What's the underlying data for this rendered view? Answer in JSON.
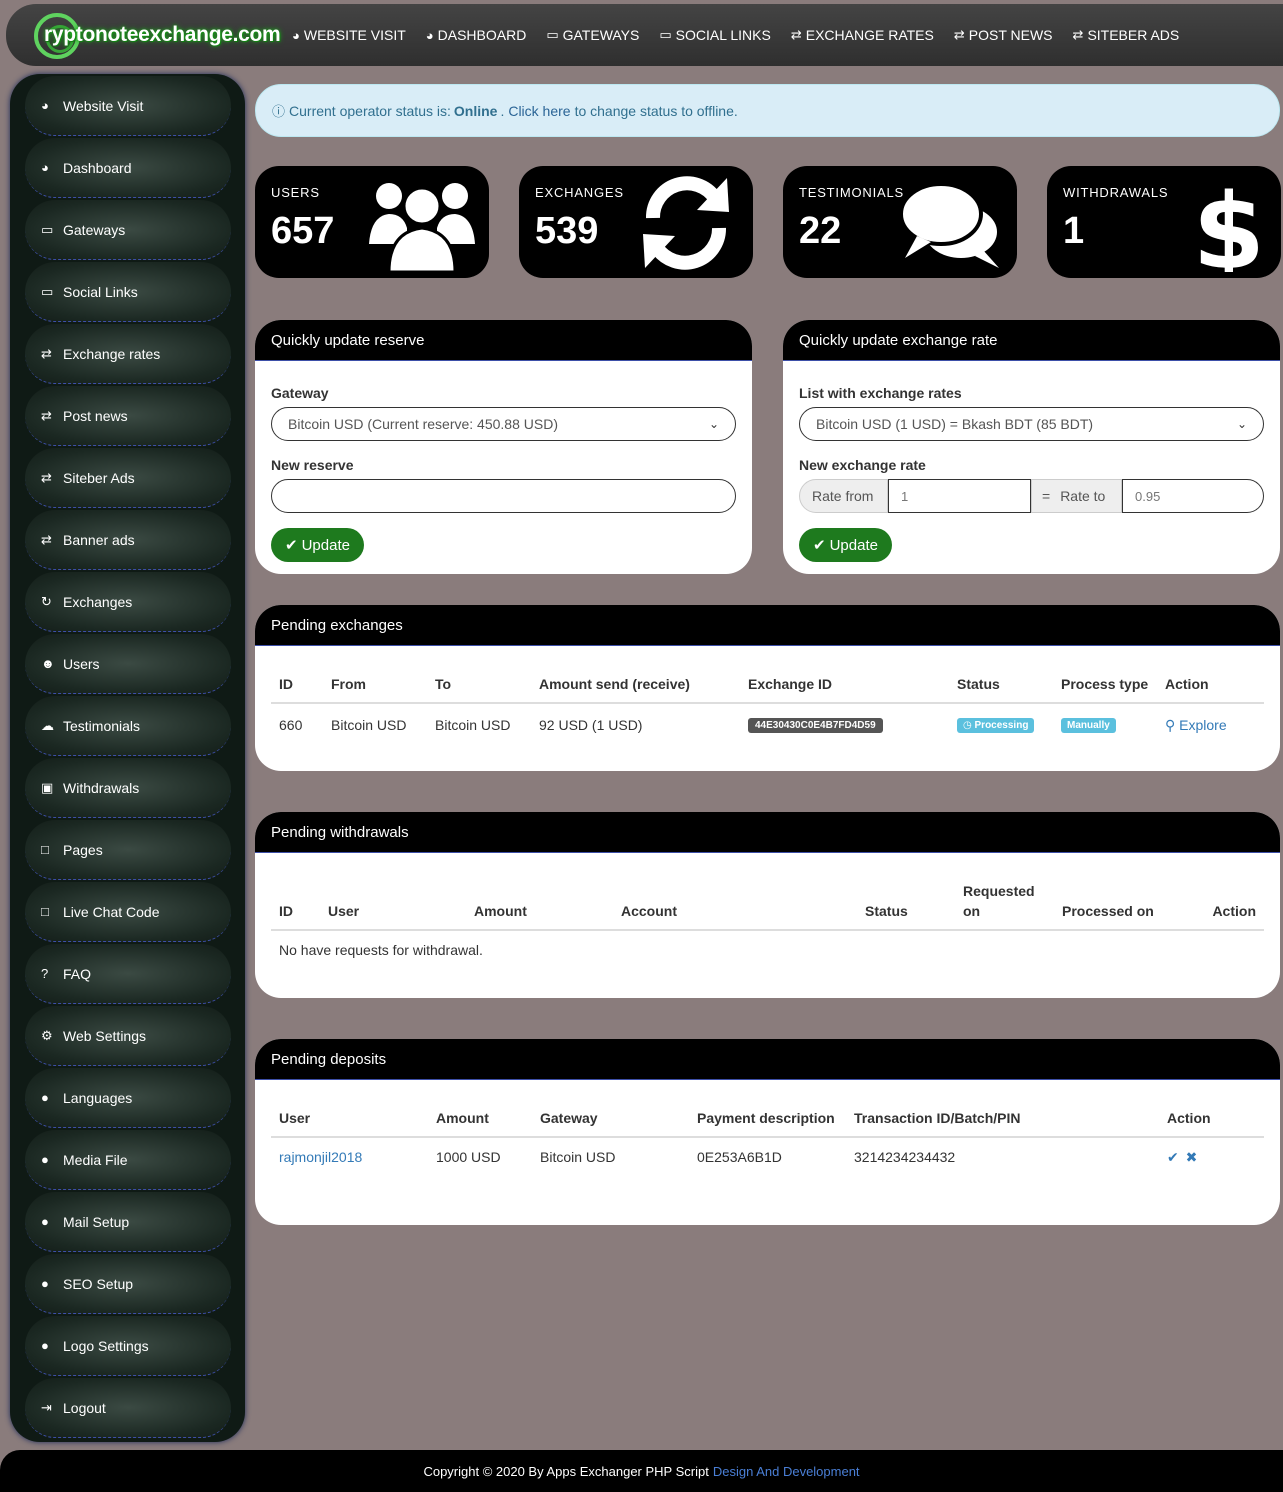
{
  "brand": {
    "name": "ryptonoteexchange.com"
  },
  "topnav": [
    {
      "icon": "dashboard-icon",
      "glyph": "◕",
      "label": "WEBSITE VISIT"
    },
    {
      "icon": "dashboard-icon",
      "glyph": "◕",
      "label": "DASHBOARD"
    },
    {
      "icon": "card-icon",
      "glyph": "▭",
      "label": "GATEWAYS"
    },
    {
      "icon": "card-icon",
      "glyph": "▭",
      "label": "SOCIAL LINKS"
    },
    {
      "icon": "exchange-icon",
      "glyph": "⇄",
      "label": "EXCHANGE RATES"
    },
    {
      "icon": "exchange-icon",
      "glyph": "⇄",
      "label": "POST NEWS"
    },
    {
      "icon": "exchange-icon",
      "glyph": "⇄",
      "label": "SITEBER ADS"
    }
  ],
  "sidebar": [
    {
      "icon": "dashboard-icon",
      "glyph": "◕",
      "label": "Website Visit"
    },
    {
      "icon": "dashboard-icon",
      "glyph": "◕",
      "label": "Dashboard"
    },
    {
      "icon": "card-icon",
      "glyph": "▭",
      "label": "Gateways"
    },
    {
      "icon": "card-icon",
      "glyph": "▭",
      "label": "Social Links"
    },
    {
      "icon": "exchange-icon",
      "glyph": "⇄",
      "label": "Exchange rates"
    },
    {
      "icon": "exchange-icon",
      "glyph": "⇄",
      "label": "Post news"
    },
    {
      "icon": "exchange-icon",
      "glyph": "⇄",
      "label": "Siteber Ads"
    },
    {
      "icon": "exchange-icon",
      "glyph": "⇄",
      "label": "Banner ads"
    },
    {
      "icon": "refresh-icon",
      "glyph": "↻",
      "label": "Exchanges"
    },
    {
      "icon": "users-icon",
      "glyph": "☻",
      "label": "Users"
    },
    {
      "icon": "comments-icon",
      "glyph": "☁",
      "label": "Testimonials"
    },
    {
      "icon": "money-icon",
      "glyph": "▣",
      "label": "Withdrawals"
    },
    {
      "icon": "folder-icon",
      "glyph": "□",
      "label": "Pages"
    },
    {
      "icon": "folder-icon",
      "glyph": "□",
      "label": "Live Chat Code"
    },
    {
      "icon": "question-icon",
      "glyph": "?",
      "label": "FAQ"
    },
    {
      "icon": "gears-icon",
      "glyph": "⚙",
      "label": "Web Settings"
    },
    {
      "icon": "globe-icon",
      "glyph": "●",
      "label": "Languages"
    },
    {
      "icon": "globe-icon",
      "glyph": "●",
      "label": "Media File"
    },
    {
      "icon": "globe-icon",
      "glyph": "●",
      "label": "Mail Setup"
    },
    {
      "icon": "globe-icon",
      "glyph": "●",
      "label": "SEO Setup"
    },
    {
      "icon": "globe-icon",
      "glyph": "●",
      "label": "Logo Settings"
    },
    {
      "icon": "signout-icon",
      "glyph": "⇥",
      "label": "Logout"
    }
  ],
  "alert": {
    "prefix": "Current operator status is:",
    "status": "Online",
    "link": "Click here",
    "suffix": "to change status to offline."
  },
  "stats": [
    {
      "label": "USERS",
      "value": "657",
      "icon": "users-icon"
    },
    {
      "label": "EXCHANGES",
      "value": "539",
      "icon": "refresh-icon"
    },
    {
      "label": "TESTIMONIALS",
      "value": "22",
      "icon": "comments-icon"
    },
    {
      "label": "WITHDRAWALS",
      "value": "1",
      "icon": "dollar-icon"
    }
  ],
  "reserve": {
    "title": "Quickly update reserve",
    "gateway_label": "Gateway",
    "gateway_value": "Bitcoin USD (Current reserve: 450.88 USD)",
    "new_label": "New reserve",
    "button": "Update"
  },
  "rate": {
    "title": "Quickly update exchange rate",
    "list_label": "List with exchange rates",
    "list_value": "Bitcoin USD (1 USD) = Bkash BDT (85 BDT)",
    "new_label": "New exchange rate",
    "from_addon": "Rate from",
    "from_value": "1",
    "eq": "=",
    "to_addon": "Rate to",
    "to_value": "0.95",
    "button": "Update"
  },
  "pending_exchanges": {
    "title": "Pending exchanges",
    "headers": [
      "ID",
      "From",
      "To",
      "Amount send (receive)",
      "Exchange ID",
      "Status",
      "Process type",
      "Action"
    ],
    "rows": [
      {
        "id": "660",
        "from": "Bitcoin USD",
        "to": "Bitcoin USD",
        "amount": "92 USD (1 USD)",
        "exchange_id": "44E30430C0E4B7FD4D59",
        "status": "Processing",
        "process": "Manually",
        "action": "Explore"
      }
    ]
  },
  "pending_withdrawals": {
    "title": "Pending withdrawals",
    "headers": [
      "ID",
      "User",
      "Amount",
      "Account",
      "Status",
      "Requested on",
      "Processed on",
      "Action"
    ],
    "empty": "No have requests for withdrawal."
  },
  "pending_deposits": {
    "title": "Pending deposits",
    "headers": [
      "User",
      "Amount",
      "Gateway",
      "Payment description",
      "Transaction ID/Batch/PIN",
      "Action"
    ],
    "rows": [
      {
        "user": "rajmonjil2018",
        "amount": "1000 USD",
        "gateway": "Bitcoin USD",
        "desc": "0E253A6B1D",
        "txn": "3214234234432"
      }
    ]
  },
  "footer": {
    "text": "Copyright © 2020 By Apps Exchanger PHP Script",
    "link": "Design And Development"
  },
  "colors": {
    "background": "#8a7c7c",
    "accent_green": "#1e7a1e",
    "link": "#337ab7",
    "info_badge": "#5bc0de"
  }
}
